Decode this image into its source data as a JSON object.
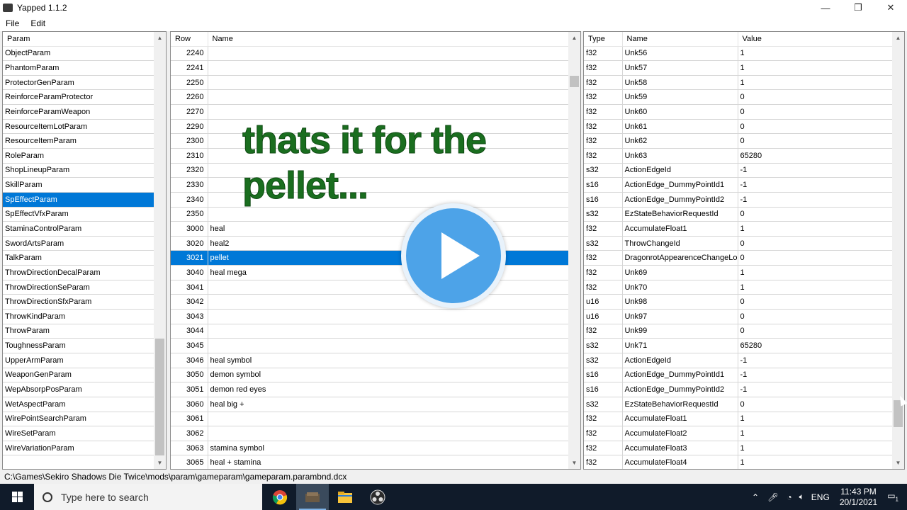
{
  "window": {
    "title": "Yapped 1.1.2",
    "minimize": "—",
    "restore": "❐",
    "close": "✕"
  },
  "menu": [
    "File",
    "Edit"
  ],
  "params_panel": {
    "header": "Param",
    "items": [
      "ObjectParam",
      "PhantomParam",
      "ProtectorGenParam",
      "ReinforceParamProtector",
      "ReinforceParamWeapon",
      "ResourceItemLotParam",
      "ResourceItemParam",
      "RoleParam",
      "ShopLineupParam",
      "SkillParam",
      "SpEffectParam",
      "SpEffectVfxParam",
      "StaminaControlParam",
      "SwordArtsParam",
      "TalkParam",
      "ThrowDirectionDecalParam",
      "ThrowDirectionSeParam",
      "ThrowDirectionSfxParam",
      "ThrowKindParam",
      "ThrowParam",
      "ToughnessParam",
      "UpperArmParam",
      "WeaponGenParam",
      "WepAbsorpPosParam",
      "WetAspectParam",
      "WirePointSearchParam",
      "WireSetParam",
      "WireVariationParam"
    ],
    "selected_index": 10
  },
  "rows_panel": {
    "headers": [
      "Row",
      "Name"
    ],
    "rows": [
      [
        "2240",
        ""
      ],
      [
        "2241",
        ""
      ],
      [
        "2250",
        ""
      ],
      [
        "2260",
        ""
      ],
      [
        "2270",
        ""
      ],
      [
        "2290",
        ""
      ],
      [
        "2300",
        ""
      ],
      [
        "2310",
        ""
      ],
      [
        "2320",
        ""
      ],
      [
        "2330",
        ""
      ],
      [
        "2340",
        ""
      ],
      [
        "2350",
        ""
      ],
      [
        "3000",
        "heal"
      ],
      [
        "3020",
        "heal2"
      ],
      [
        "3021",
        "pellet"
      ],
      [
        "3040",
        "heal mega"
      ],
      [
        "3041",
        ""
      ],
      [
        "3042",
        ""
      ],
      [
        "3043",
        ""
      ],
      [
        "3044",
        ""
      ],
      [
        "3045",
        ""
      ],
      [
        "3046",
        "heal symbol"
      ],
      [
        "3050",
        "demon symbol"
      ],
      [
        "3051",
        "demon red eyes"
      ],
      [
        "3060",
        "heal big +"
      ],
      [
        "3061",
        ""
      ],
      [
        "3062",
        ""
      ],
      [
        "3063",
        "stamina symbol"
      ],
      [
        "3065",
        "heal + stamina"
      ]
    ],
    "selected_index": 14
  },
  "fields_panel": {
    "headers": [
      "Type",
      "Name",
      "Value"
    ],
    "rows": [
      [
        "f32",
        "Unk56",
        "1"
      ],
      [
        "f32",
        "Unk57",
        "1"
      ],
      [
        "f32",
        "Unk58",
        "1"
      ],
      [
        "f32",
        "Unk59",
        "0"
      ],
      [
        "f32",
        "Unk60",
        "0"
      ],
      [
        "f32",
        "Unk61",
        "0"
      ],
      [
        "f32",
        "Unk62",
        "0"
      ],
      [
        "f32",
        "Unk63",
        "65280"
      ],
      [
        "s32",
        "ActionEdgeId",
        "-1"
      ],
      [
        "s16",
        "ActionEdge_DummyPointId1",
        "-1"
      ],
      [
        "s16",
        "ActionEdge_DummyPointId2",
        "-1"
      ],
      [
        "s32",
        "EzStateBehaviorRequestId",
        "0"
      ],
      [
        "f32",
        "AccumulateFloat1",
        "1"
      ],
      [
        "s32",
        "ThrowChangeId",
        "0"
      ],
      [
        "f32",
        "DragonrotAppearenceChangeLoop",
        "0"
      ],
      [
        "f32",
        "Unk69",
        "1"
      ],
      [
        "f32",
        "Unk70",
        "1"
      ],
      [
        "u16",
        "Unk98",
        "0"
      ],
      [
        "u16",
        "Unk97",
        "0"
      ],
      [
        "f32",
        "Unk99",
        "0"
      ],
      [
        "s32",
        "Unk71",
        "65280"
      ],
      [
        "s32",
        "ActionEdgeId",
        "-1"
      ],
      [
        "s16",
        "ActionEdge_DummyPointId1",
        "-1"
      ],
      [
        "s16",
        "ActionEdge_DummyPointId2",
        "-1"
      ],
      [
        "s32",
        "EzStateBehaviorRequestId",
        "0"
      ],
      [
        "f32",
        "AccumulateFloat1",
        "1"
      ],
      [
        "f32",
        "AccumulateFloat2",
        "1"
      ],
      [
        "f32",
        "AccumulateFloat3",
        "1"
      ],
      [
        "f32",
        "AccumulateFloat4",
        "1"
      ]
    ]
  },
  "status_path": "C:\\Games\\Sekiro Shadows Die Twice\\mods\\param\\gameparam\\gameparam.parambnd.dcx",
  "overlay": {
    "line1": "thats it for the",
    "line2": "pellet..."
  },
  "taskbar": {
    "search_placeholder": "Type here to search",
    "lang": "ENG",
    "time": "11:43 PM",
    "date": "20/1/2021",
    "notification_count": "1"
  },
  "colors": {
    "selection": "#0078d7",
    "overlay_text": "#1a6e1f",
    "play_button": "#4da3e8",
    "taskbar": "#101b2a"
  }
}
